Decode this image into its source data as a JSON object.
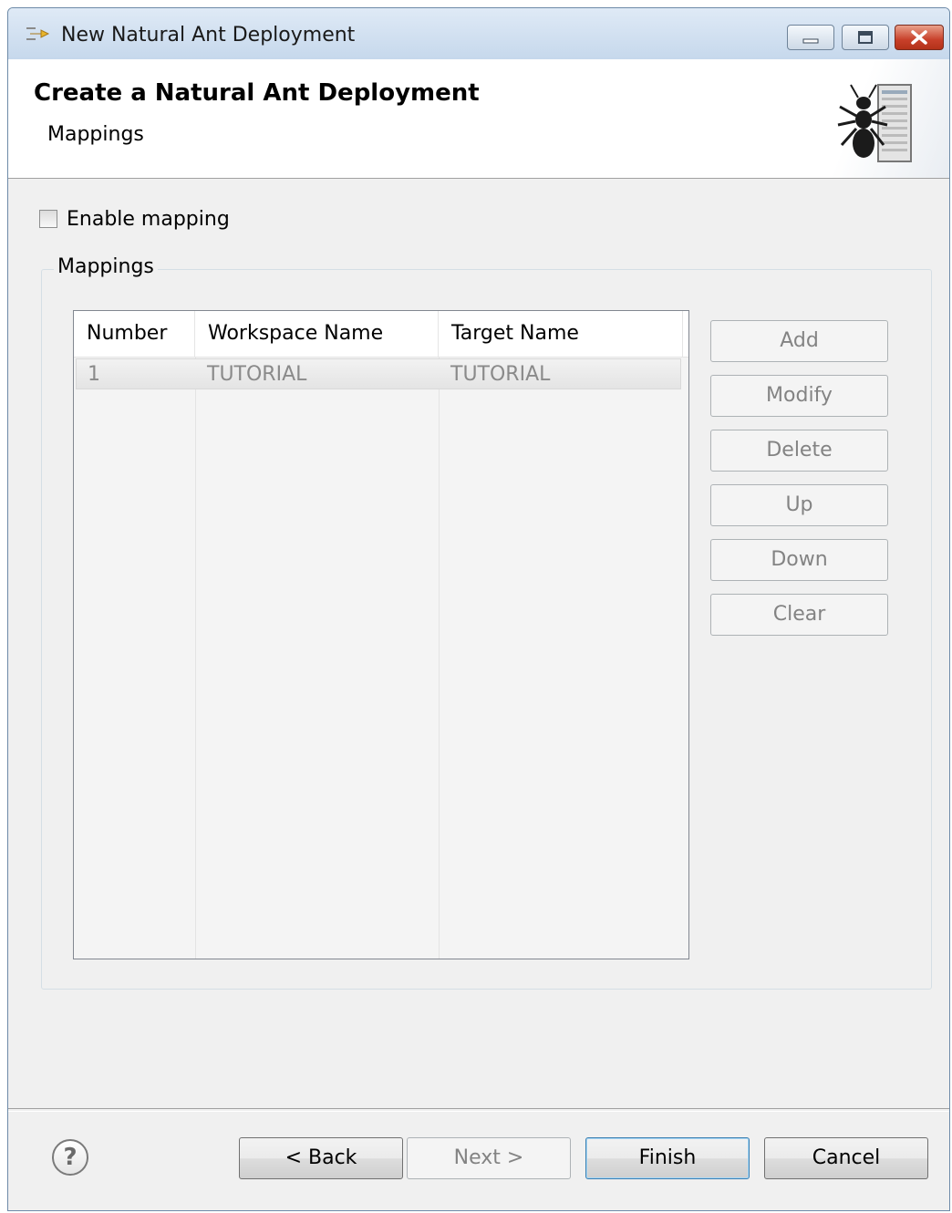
{
  "window": {
    "title": "New Natural Ant Deployment",
    "controls": [
      "minimize",
      "maximize",
      "close"
    ]
  },
  "header": {
    "title": "Create a Natural Ant Deployment",
    "subtitle": "Mappings",
    "icon": "ant-server-icon"
  },
  "enable_mapping": {
    "label": "Enable mapping",
    "checked": false
  },
  "mappings_group": {
    "label": "Mappings",
    "columns": [
      "Number",
      "Workspace Name",
      "Target Name"
    ],
    "rows": [
      {
        "number": "1",
        "workspace": "TUTORIAL",
        "target": "TUTORIAL"
      }
    ],
    "buttons": {
      "add": "Add",
      "modify": "Modify",
      "delete": "Delete",
      "up": "Up",
      "down": "Down",
      "clear": "Clear"
    }
  },
  "footer": {
    "help": "?",
    "back": "< Back",
    "next": "Next >",
    "finish": "Finish",
    "cancel": "Cancel"
  }
}
